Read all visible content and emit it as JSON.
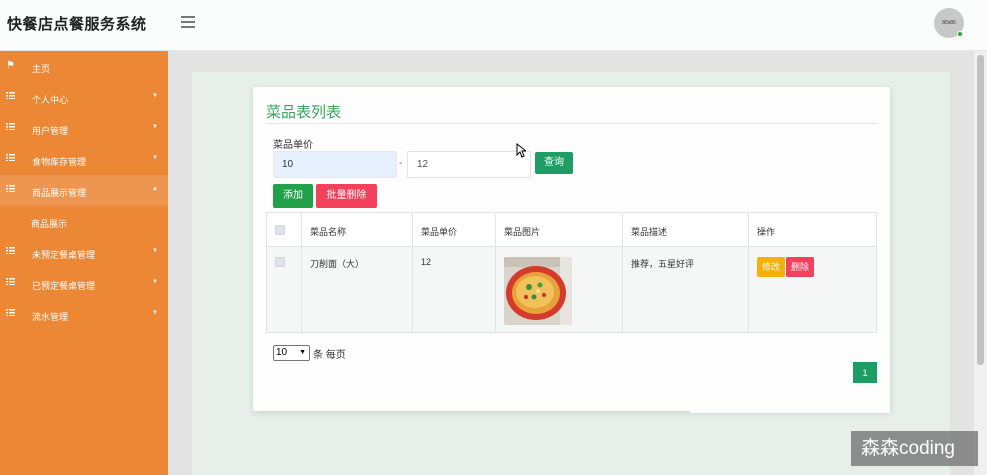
{
  "app": {
    "title": "快餐店点餐服务系统",
    "avatar_text": "80x80"
  },
  "sidebar": {
    "items": [
      {
        "label": "主页",
        "icon": "flag-icon",
        "has_caret": false
      },
      {
        "label": "个人中心",
        "icon": "list-icon",
        "has_caret": true
      },
      {
        "label": "用户管理",
        "icon": "list-icon",
        "has_caret": true
      },
      {
        "label": "食物库存管理",
        "icon": "list-icon",
        "has_caret": true
      },
      {
        "label": "商品展示管理",
        "icon": "list-icon",
        "has_caret": true,
        "active": true
      },
      {
        "label": "商品展示",
        "icon": "",
        "sub": true
      },
      {
        "label": "未预定餐桌管理",
        "icon": "list-icon",
        "has_caret": true
      },
      {
        "label": "已预定餐桌管理",
        "icon": "list-icon",
        "has_caret": true
      },
      {
        "label": "流水管理",
        "icon": "list-icon",
        "has_caret": true
      }
    ]
  },
  "panel": {
    "title": "菜品表列表",
    "search": {
      "label": "菜品单价",
      "min_value": "10",
      "separator": "-",
      "max_value": "12",
      "query_label": "查询"
    },
    "buttons": {
      "add": "添加",
      "batch_delete": "批量删除"
    },
    "table": {
      "headers": [
        "菜品名称",
        "菜品单价",
        "菜品图片",
        "菜品描述",
        "操作"
      ],
      "rows": [
        {
          "name": "刀削面（大）",
          "price": "12",
          "description": "推荐，五星好评",
          "edit": "修改",
          "delete": "删除"
        }
      ]
    },
    "pagination": {
      "page_size": "10",
      "page_size_suffix": "条 每页",
      "current_page": "1"
    }
  },
  "watermark": "森森coding",
  "colors": {
    "sidebar": "#ec8736",
    "accent": "#3aa35e",
    "primary_btn": "#1e9e64",
    "danger": "#f3405c",
    "warning": "#f5b10a"
  }
}
